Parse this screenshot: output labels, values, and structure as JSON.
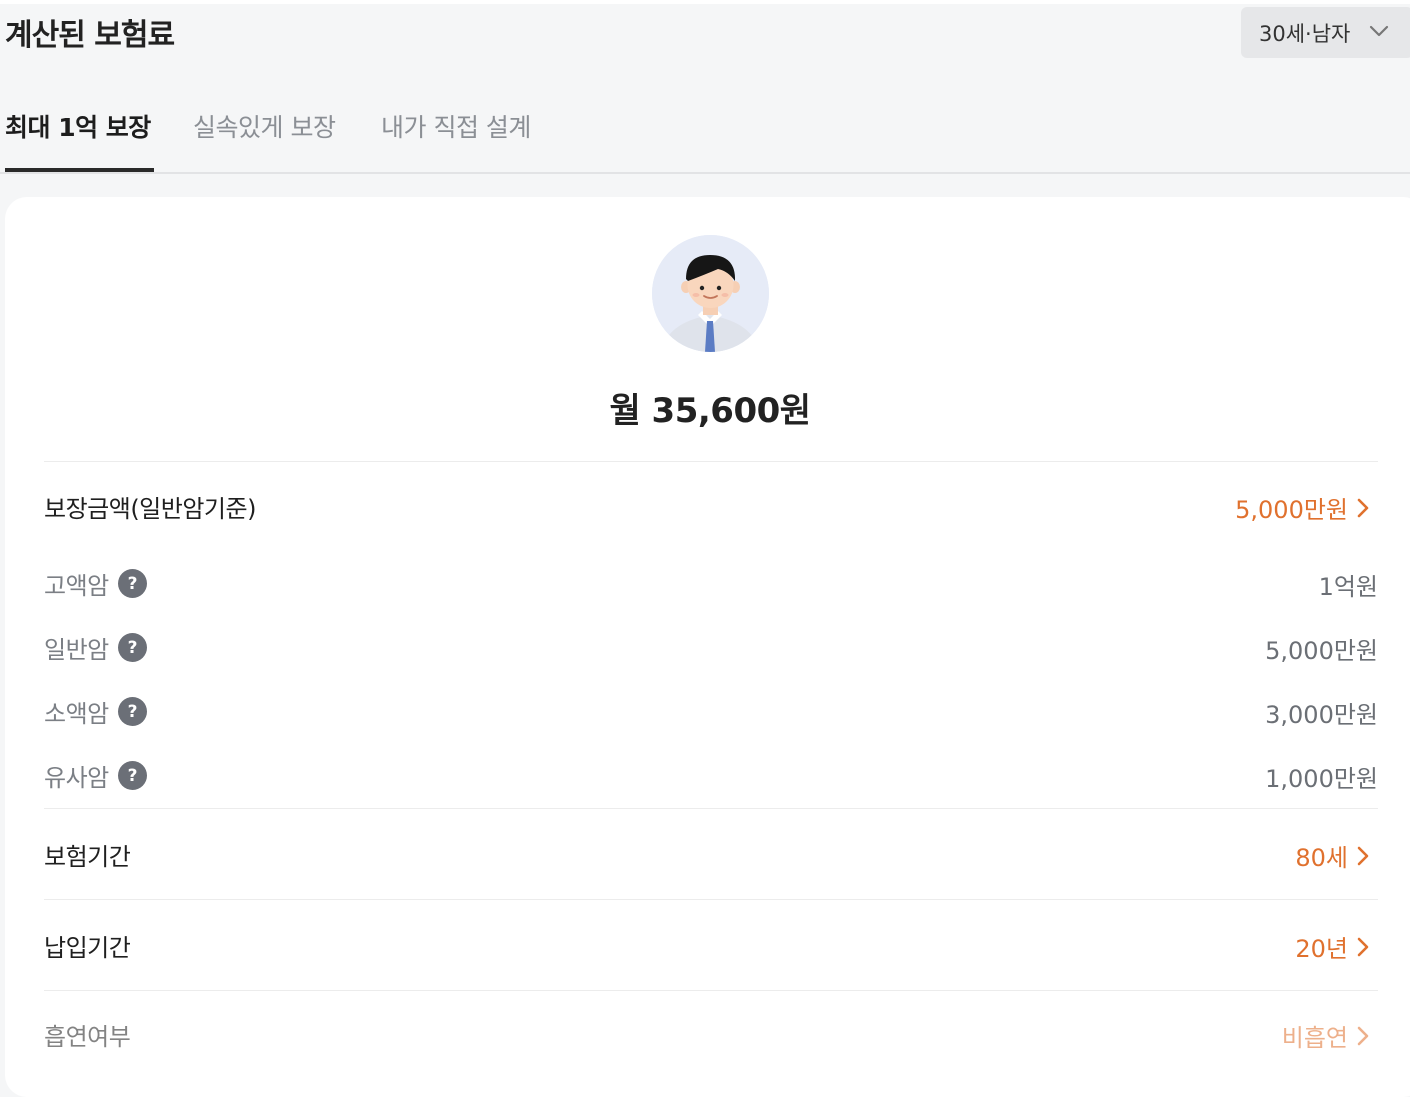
{
  "header": {
    "title": "계산된 보험료",
    "age_selector": "30세·남자"
  },
  "tabs": [
    {
      "label": "최대 1억 보장",
      "active": true
    },
    {
      "label": "실속있게 보장",
      "active": false
    },
    {
      "label": "내가 직접 설계",
      "active": false
    }
  ],
  "summary": {
    "monthly_premium": "월 35,600원"
  },
  "coverage": {
    "label": "보장금액(일반암기준)",
    "value": "5,000만원",
    "items": [
      {
        "label": "고액암",
        "value": "1억원"
      },
      {
        "label": "일반암",
        "value": "5,000만원"
      },
      {
        "label": "소액암",
        "value": "3,000만원"
      },
      {
        "label": "유사암",
        "value": "1,000만원"
      }
    ]
  },
  "insurance_period": {
    "label": "보험기간",
    "value": "80세"
  },
  "payment_period": {
    "label": "납입기간",
    "value": "20년"
  },
  "smoking": {
    "label": "흡연여부",
    "value": "비흡연"
  },
  "colors": {
    "accent": "#e0712e",
    "help_icon": "#6b6f77"
  },
  "icons": {
    "help": "question-icon",
    "chevron": "chevron-right-icon",
    "dropdown": "chevron-down-icon"
  }
}
